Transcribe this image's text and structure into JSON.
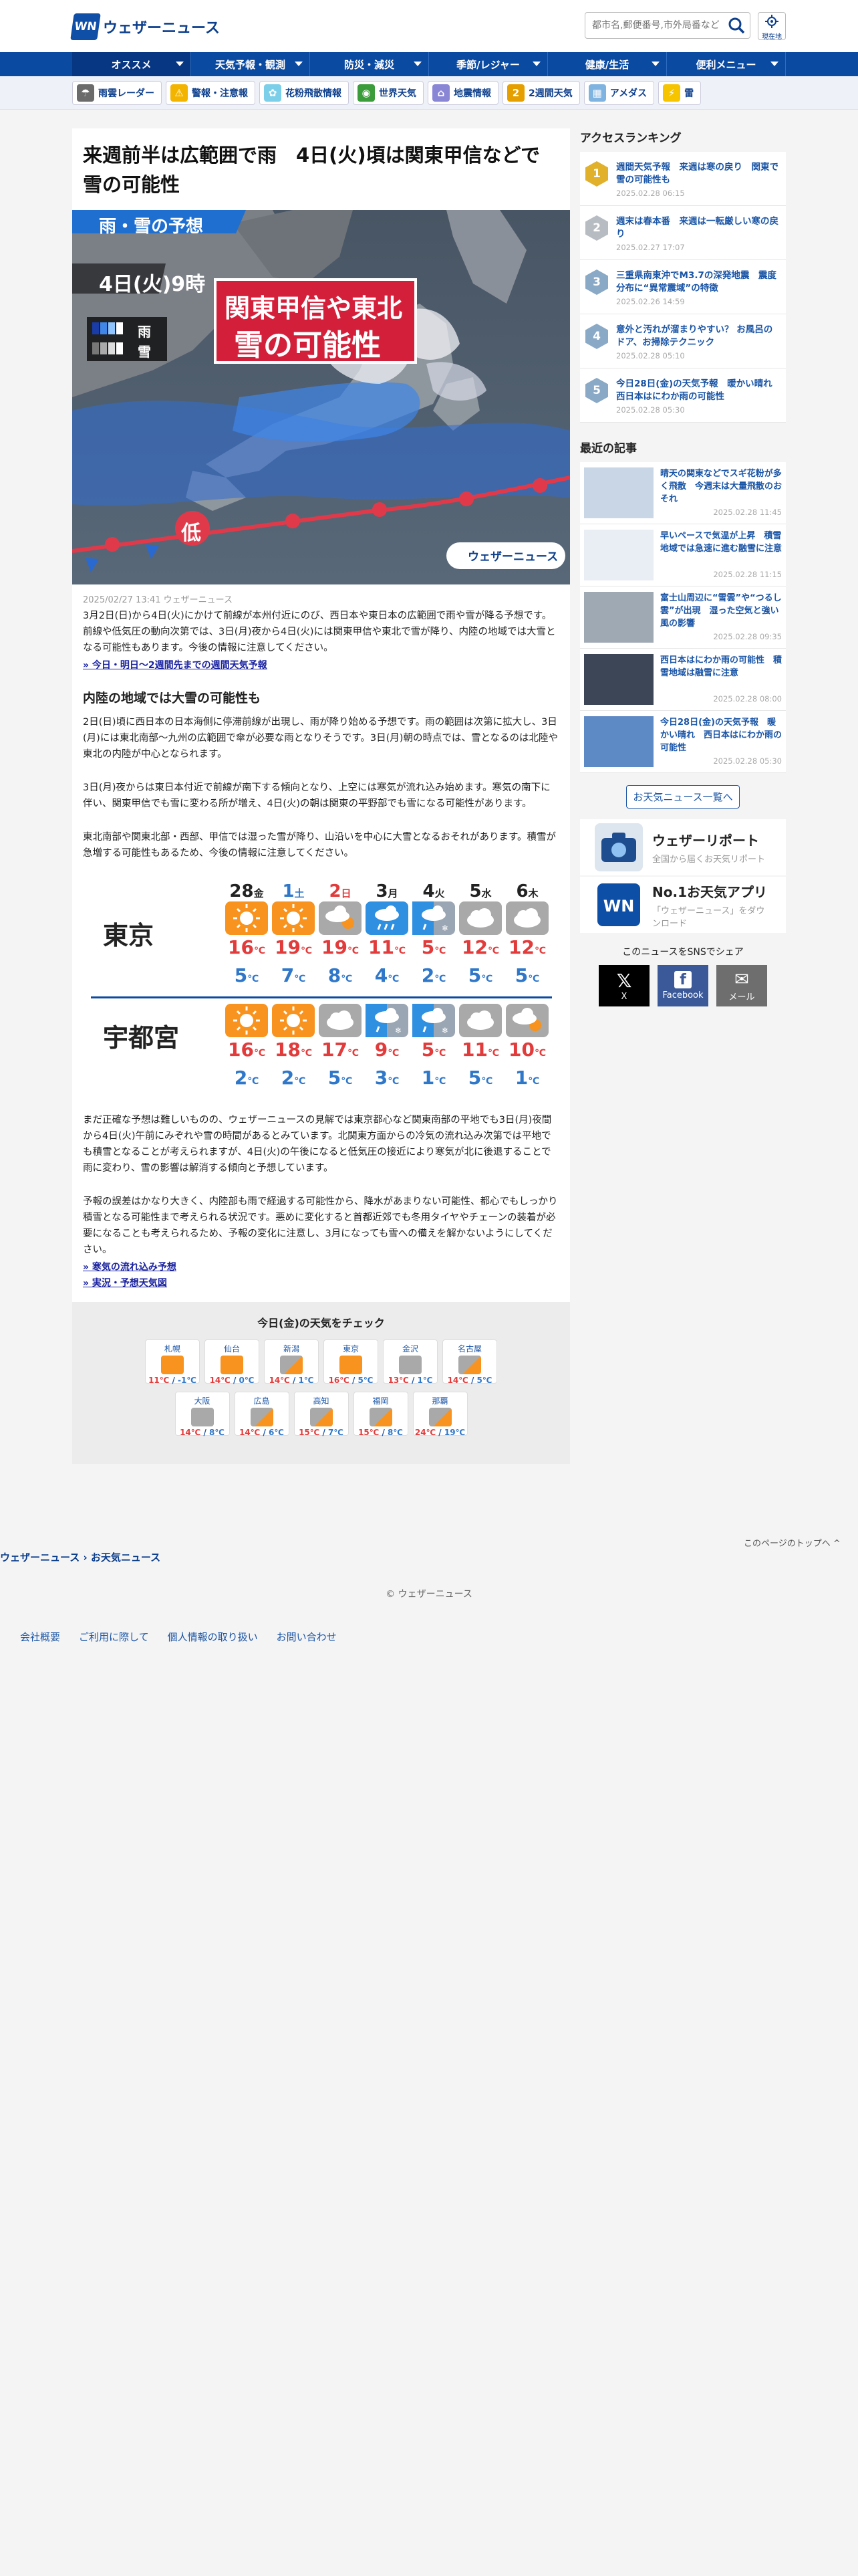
{
  "header": {
    "logo_mark": "WN",
    "logo_text": "ウェザーニュース",
    "search_placeholder": "都市名,郵便番号,市外局番など",
    "location_label": "現在地"
  },
  "nav": [
    {
      "label": "オススメ"
    },
    {
      "label": "天気予報・観測"
    },
    {
      "label": "防災・減災"
    },
    {
      "label": "季節/レジャー"
    },
    {
      "label": "健康/生活"
    },
    {
      "label": "便利メニュー"
    }
  ],
  "subnav": [
    {
      "label": "雨雲レーダー",
      "icon": "radar-icon",
      "color": "#6b6b6b",
      "glyph": "☂"
    },
    {
      "label": "警報・注意報",
      "icon": "warning-icon",
      "color": "#f3b400",
      "glyph": "⚠"
    },
    {
      "label": "花粉飛散情報",
      "icon": "pollen-icon",
      "color": "#7ccfe8",
      "glyph": "✿"
    },
    {
      "label": "世界天気",
      "icon": "globe-icon",
      "color": "#3b9c3b",
      "glyph": "◉"
    },
    {
      "label": "地震情報",
      "icon": "earthquake-icon",
      "color": "#8a86d6",
      "glyph": "⌂"
    },
    {
      "label": "2週間天気",
      "icon": "calendar-icon",
      "color": "#e5a000",
      "glyph": "2"
    },
    {
      "label": "アメダス",
      "icon": "amedas-icon",
      "color": "#7fb3e0",
      "glyph": "▦"
    },
    {
      "label": "雷",
      "icon": "lightning-icon",
      "color": "#f7c400",
      "glyph": "⚡"
    }
  ],
  "article": {
    "title": "来週前半は広範囲で雨　4日(火)頃は関東甲信などで雪の可能性",
    "hero": {
      "badge": "雨・雪の予想",
      "time": "4日(火)9時",
      "callout_1": "関東甲信や東北",
      "callout_2": "雪の可能性",
      "legend_rain": "雨",
      "legend_snow": "雪",
      "low": "低",
      "brand": "ウェザーニュース"
    },
    "meta": "2025/02/27 13:41 ウェザーニュース",
    "lead": "3月2日(日)から4日(火)にかけて前線が本州付近にのび、西日本や東日本の広範囲で雨や雪が降る予想です。前線や低気圧の動向次第では、3日(月)夜から4日(火)には関東甲信や東北で雪が降り、内陸の地域では大雪となる可能性もあります。今後の情報に注意してください。",
    "link_1": "» 今日・明日〜2週間先までの週間天気予報",
    "h2": "内陸の地域では大雪の可能性も",
    "body_1": "2日(日)頃に西日本の日本海側に停滞前線が出現し、雨が降り始める予想です。雨の範囲は次第に拡大し、3日(月)には東北南部〜九州の広範囲で傘が必要な雨となりそうです。3日(月)朝の時点では、雪となるのは北陸や東北の内陸が中心となられます。",
    "body_2": "3日(月)夜からは東日本付近で前線が南下する傾向となり、上空には寒気が流れ込み始めます。寒気の南下に伴い、関東甲信でも雪に変わる所が増え、4日(火)の朝は関東の平野部でも雪になる可能性があります。",
    "body_3": "東北南部や関東北部・西部、甲信では湿った雪が降り、山沿いを中心に大雪となるおそれがあります。積雪が急増する可能性もあるため、今後の情報に注意してください。",
    "body_4": "まだ正確な予想は難しいものの、ウェザーニュースの見解では東京都心など関東南部の平地でも3日(月)夜間から4日(火)午前にみぞれや雪の時間があるとみています。北関東方面からの冷気の流れ込み次第では平地でも積雪となることが考えられますが、4日(火)の午後になると低気圧の接近により寒気が北に後退することで雨に変わり、雪の影響は解消する傾向と予想しています。",
    "body_5": "予報の誤差はかなり大きく、内陸部も雨で経過する可能性から、降水があまりない可能性、都心でもしっかり積雪となる可能性まで考えられる状況です。悪めに変化すると首都近郊でも冬用タイヤやチェーンの装着が必要になることも考えられるため、予報の変化に注意し、3月になっても雪への備えを解かないようにしてください。",
    "link_2": "» 寒気の流れ込み予想",
    "link_3": "» 実況・予想天気図"
  },
  "forecast": {
    "days": [
      {
        "date": "28",
        "dow": "金",
        "color": "#222"
      },
      {
        "date": "1",
        "dow": "土",
        "color": "#2f77c9"
      },
      {
        "date": "2",
        "dow": "日",
        "color": "#e23b3b"
      },
      {
        "date": "3",
        "dow": "月",
        "color": "#222"
      },
      {
        "date": "4",
        "dow": "火",
        "color": "#222"
      },
      {
        "date": "5",
        "dow": "水",
        "color": "#222"
      },
      {
        "date": "6",
        "dow": "木",
        "color": "#222"
      }
    ],
    "cities": [
      {
        "name": "東京",
        "wx": [
          "sun",
          "sun",
          "cs",
          "rain",
          "rs",
          "cloud",
          "cloud"
        ],
        "hi": [
          "16",
          "19",
          "19",
          "11",
          "5",
          "12",
          "12"
        ],
        "lo": [
          "5",
          "7",
          "8",
          "4",
          "2",
          "5",
          "5"
        ]
      },
      {
        "name": "宇都宮",
        "wx": [
          "sun",
          "sun",
          "cloud",
          "rs",
          "rs",
          "cloud",
          "cs"
        ],
        "hi": [
          "16",
          "18",
          "17",
          "9",
          "5",
          "11",
          "10"
        ],
        "lo": [
          "2",
          "2",
          "5",
          "3",
          "1",
          "5",
          "1"
        ]
      }
    ],
    "unit": "℃"
  },
  "check": {
    "title": "今日(金)の天気をチェック",
    "row1": [
      {
        "name": "札幌",
        "wx": "sun",
        "hi": "11",
        "lo": "-1"
      },
      {
        "name": "仙台",
        "wx": "sun",
        "hi": "14",
        "lo": "0"
      },
      {
        "name": "新潟",
        "wx": "cs",
        "hi": "14",
        "lo": "1"
      },
      {
        "name": "東京",
        "wx": "sun",
        "hi": "16",
        "lo": "5"
      },
      {
        "name": "金沢",
        "wx": "cloud",
        "hi": "13",
        "lo": "1"
      },
      {
        "name": "名古屋",
        "wx": "cs",
        "hi": "14",
        "lo": "5"
      }
    ],
    "row2": [
      {
        "name": "大阪",
        "wx": "cloud",
        "hi": "14",
        "lo": "8"
      },
      {
        "name": "広島",
        "wx": "cs",
        "hi": "14",
        "lo": "6"
      },
      {
        "name": "高知",
        "wx": "cs",
        "hi": "15",
        "lo": "7"
      },
      {
        "name": "福岡",
        "wx": "cs",
        "hi": "15",
        "lo": "8"
      },
      {
        "name": "那覇",
        "wx": "cs",
        "hi": "24",
        "lo": "19"
      }
    ]
  },
  "sidebar": {
    "ranking_title": "アクセスランキング",
    "ranking": [
      {
        "n": "1",
        "title": "週間天気予報　来週は寒の戻り　関東で雪の可能性も",
        "date": "2025.02.28 06:15",
        "color": "#e1b12c"
      },
      {
        "n": "2",
        "title": "週末は春本番　来週は一転厳しい寒の戻り",
        "date": "2025.02.27 17:07",
        "color": "#b7bcc2"
      },
      {
        "n": "3",
        "title": "三重県南東沖でM3.7の深発地震　震度分布に“異常震域”の特徴",
        "date": "2025.02.26 14:59",
        "color": "#8aa9c6"
      },
      {
        "n": "4",
        "title": "意外と汚れが溜まりやすい？ お風呂のドア、お掃除テクニック",
        "date": "2025.02.28 05:10",
        "color": "#8aa9c6"
      },
      {
        "n": "5",
        "title": "今日28日(金)の天気予報　暖かい晴れ　西日本はにわか雨の可能性",
        "date": "2025.02.28 05:30",
        "color": "#8aa9c6"
      }
    ],
    "recent_title": "最近の記事",
    "recent": [
      {
        "title": "晴天の関東などでスギ花粉が多く飛散　今週末は大量飛散のおそれ",
        "date": "2025.02.28 11:45",
        "img": "#c8d6e5"
      },
      {
        "title": "早いペースで気温が上昇　積雪地域では急速に進む融雪に注意",
        "date": "2025.02.28 11:15",
        "img": "#e8eef4"
      },
      {
        "title": "富士山周辺に“雪雲”や“つるし雲”が出現　湿った空気と強い風の影響",
        "date": "2025.02.28 09:35",
        "img": "#9fa9b3"
      },
      {
        "title": "西日本はにわか雨の可能性　積雪地域は融雪に注意",
        "date": "2025.02.28 08:00",
        "img": "#3c4656"
      },
      {
        "title": "今日28日(金)の天気予報　暖かい晴れ　西日本はにわか雨の可能性",
        "date": "2025.02.28 05:30",
        "img": "#5d89c4"
      }
    ],
    "more": "お天気ニュース一覧へ",
    "promo_1_title": "ウェザーリポート",
    "promo_1_sub": "全国から届くお天気リポート",
    "promo_2_title": "No.1お天気アプリ",
    "promo_2_sub": "「ウェザーニュース」をダウンロード",
    "share_title": "このニュースをSNSでシェア",
    "share_x": "X",
    "share_fb": "Facebook",
    "share_mail": "メール"
  },
  "footer": {
    "to_top": "このページのトップへ ^",
    "bc_1": "ウェザーニュース",
    "bc_sep": " › ",
    "bc_2": "お天気ニュース",
    "copyright": "© ウェザーニュース",
    "links": [
      "会社概要",
      "ご利用に際して",
      "個人情報の取り扱い",
      "お問い合わせ"
    ]
  },
  "colors": {
    "brand": "#0b4aa1",
    "accent_red": "#e23b3b",
    "accent_blue": "#2f77c9"
  }
}
